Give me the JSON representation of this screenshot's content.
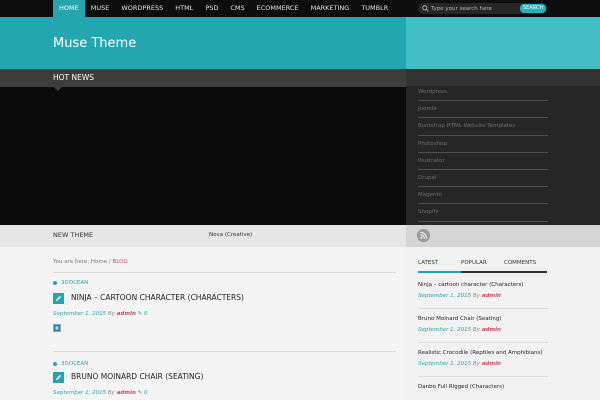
{
  "nav": {
    "items": [
      {
        "label": "HOME",
        "active": true
      },
      {
        "label": "MUSE"
      },
      {
        "label": "WORDPRESS"
      },
      {
        "label": "HTML"
      },
      {
        "label": "PSD"
      },
      {
        "label": "CMS"
      },
      {
        "label": "ECOMMERCE"
      },
      {
        "label": "MARKETING"
      },
      {
        "label": "TUMBLR"
      }
    ],
    "search": {
      "placeholder": "Type your search here",
      "button_label": "SEARCH"
    }
  },
  "header": {
    "site_title": "Muse Theme"
  },
  "hot_news": {
    "title": "HOT NEWS"
  },
  "categories": [
    "Wordpress",
    "Joomla",
    "Bootstrap HTML Website Templates",
    "Photoshop",
    "Illustrator",
    "Drupal",
    "Magento",
    "Shopify"
  ],
  "strip": {
    "title": "NEW THEME",
    "ticker": "Nova (Creative)"
  },
  "breadcrumb": {
    "prefix": "You are here:",
    "home": "Home",
    "separator": "/",
    "current": "BLOG"
  },
  "posts": [
    {
      "category": "3DOCEAN",
      "title": "NINJA – CARTOON CHARACTER (CHARACTERS)",
      "date": "September 1, 2015",
      "by": "By",
      "author": "admin",
      "comments": "0"
    },
    {
      "category": "3DOCEAN",
      "title": "BRUNO MOINARD CHAIR (SEATING)",
      "date": "September 1, 2015",
      "by": "By",
      "author": "admin",
      "comments": "0"
    }
  ],
  "sidebar": {
    "tabs": [
      {
        "label": "LATEST",
        "active": true
      },
      {
        "label": "POPULAR"
      },
      {
        "label": "COMMENTS"
      }
    ],
    "posts": [
      {
        "title": "Ninja – cartoon character (Characters)",
        "date": "September 1, 2015",
        "by": "By",
        "author": "admin"
      },
      {
        "title": "Bruno Moinard Chair (Seating)",
        "date": "September 1, 2015",
        "by": "By",
        "author": "admin"
      },
      {
        "title": "Realistic Crocodile (Reptiles and Amphibians)",
        "date": "September 1, 2015",
        "by": "By",
        "author": "admin"
      },
      {
        "title": "Danbo Full Rigged (Characters)",
        "date": "",
        "by": "",
        "author": ""
      }
    ]
  },
  "colors": {
    "accent": "#26a5ae",
    "header": "#24a6b1",
    "author": "#c84a5a"
  }
}
